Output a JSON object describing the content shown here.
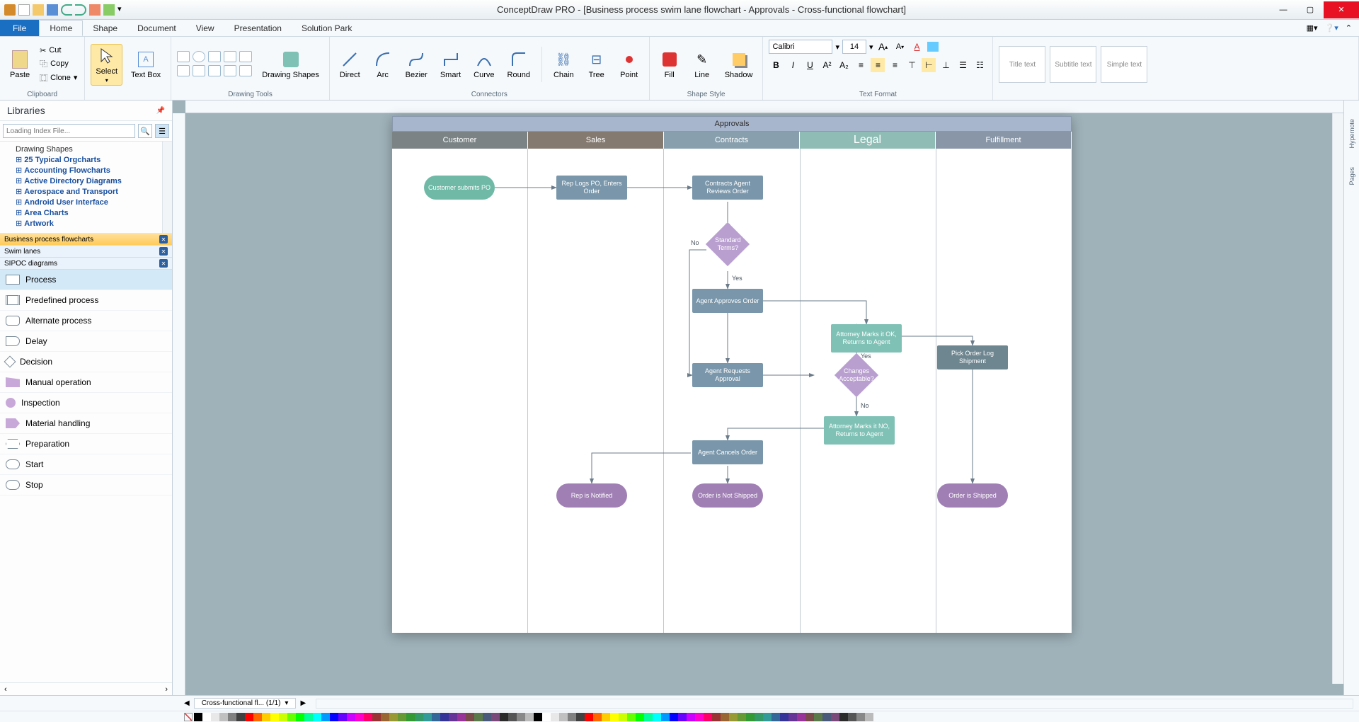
{
  "title": "ConceptDraw PRO - [Business process swim lane flowchart - Approvals - Cross-functional flowchart]",
  "qat_icons": [
    "app",
    "new",
    "open",
    "save",
    "undo",
    "redo",
    "print",
    "cut",
    "copy"
  ],
  "menu_right_icons": [
    "grid-settings",
    "help",
    "dropdown"
  ],
  "tabs": [
    "File",
    "Home",
    "Shape",
    "Document",
    "View",
    "Presentation",
    "Solution Park"
  ],
  "active_tab": "Home",
  "ribbon": {
    "clipboard": {
      "label": "Clipboard",
      "paste": "Paste",
      "cut": "Cut",
      "copy": "Copy",
      "clone": "Clone"
    },
    "select": {
      "label": "Select"
    },
    "textbox": {
      "label": "Text Box"
    },
    "drawing_tools": {
      "label": "Drawing Tools",
      "shapes": "Drawing Shapes"
    },
    "connectors": {
      "label": "Connectors",
      "items": [
        "Direct",
        "Arc",
        "Bezier",
        "Smart",
        "Curve",
        "Round"
      ],
      "chain": "Chain",
      "tree": "Tree",
      "point": "Point"
    },
    "shape_style": {
      "label": "Shape Style",
      "fill": "Fill",
      "line": "Line",
      "shadow": "Shadow"
    },
    "text_format": {
      "label": "Text Format",
      "font": "Calibri",
      "size": "14"
    },
    "quick_styles": [
      "Title text",
      "Subtitle text",
      "Simple text"
    ]
  },
  "libraries": {
    "title": "Libraries",
    "search_placeholder": "Loading Index File...",
    "tree": [
      "Drawing Shapes",
      "25 Typical Orgcharts",
      "Accounting Flowcharts",
      "Active Directory Diagrams",
      "Aerospace and Transport",
      "Android User Interface",
      "Area Charts",
      "Artwork"
    ],
    "open_tabs": [
      {
        "label": "Business process flowcharts",
        "active": true
      },
      {
        "label": "Swim lanes",
        "active": false
      },
      {
        "label": "SIPOC diagrams",
        "active": false
      }
    ],
    "shapes": [
      "Process",
      "Predefined process",
      "Alternate process",
      "Delay",
      "Decision",
      "Manual operation",
      "Inspection",
      "Material handling",
      "Preparation",
      "Start",
      "Stop"
    ],
    "selected_shape": "Process"
  },
  "page_tab": "Cross-functional fl... (1/1)",
  "swim": {
    "title": "Approvals",
    "lanes": [
      {
        "label": "Customer",
        "color": "#7b8385"
      },
      {
        "label": "Sales",
        "color": "#847a70"
      },
      {
        "label": "Contracts",
        "color": "#88a0ae"
      },
      {
        "label": "Legal",
        "color": "#7fb2ab",
        "selected": true
      },
      {
        "label": "Fulfillment",
        "color": "#8896a8"
      }
    ],
    "nodes": {
      "start": {
        "text": "Customer submits PO",
        "color": "#6fb9a6"
      },
      "replog": {
        "text": "Rep Logs PO, Enters Order",
        "color": "#7996aa"
      },
      "review": {
        "text": "Contracts Agent Reviews Order",
        "color": "#7996aa"
      },
      "std": {
        "text": "Standard Terms?",
        "color": "#b99fcf"
      },
      "approve": {
        "text": "Agent Approves Order",
        "color": "#7996aa"
      },
      "attok": {
        "text": "Attorney Marks it OK, Returns to Agent",
        "color": "#7fc1b5"
      },
      "pick": {
        "text": "Pick Order Log Shipment",
        "color": "#6e8690"
      },
      "reqapp": {
        "text": "Agent Requests Approval",
        "color": "#7996aa"
      },
      "changes": {
        "text": "Changes Acceptable?",
        "color": "#b99fcf"
      },
      "attno": {
        "text": "Attorney Marks it NO, Returns to Agent",
        "color": "#7fc1b5"
      },
      "cancel": {
        "text": "Agent Cancels Order",
        "color": "#7996aa"
      },
      "repnot": {
        "text": "Rep is Notified",
        "color": "#a07fb4"
      },
      "notship": {
        "text": "Order is Not Shipped",
        "color": "#a07fb4"
      },
      "shipped": {
        "text": "Order is Shipped",
        "color": "#a07fb4"
      }
    },
    "edge_labels": {
      "no": "No",
      "yes": "Yes",
      "yes2": "Yes",
      "no2": "No"
    }
  },
  "palette": [
    "#000000",
    "#ffffff",
    "#e8e8e8",
    "#c0c0c0",
    "#808080",
    "#404040",
    "#ff0000",
    "#ff6600",
    "#ffcc00",
    "#ffff00",
    "#ccff00",
    "#66ff00",
    "#00ff00",
    "#00ff99",
    "#00ffff",
    "#0099ff",
    "#0000ff",
    "#6600ff",
    "#cc00ff",
    "#ff00cc",
    "#ff0066",
    "#993333",
    "#996633",
    "#999933",
    "#669933",
    "#339933",
    "#339966",
    "#339999",
    "#336699",
    "#333399",
    "#663399",
    "#993399",
    "#7a4a4a",
    "#5a7a4a",
    "#4a5a7a",
    "#7a4a7a",
    "#2a2a2a",
    "#555555",
    "#888888",
    "#bbbbbb"
  ]
}
